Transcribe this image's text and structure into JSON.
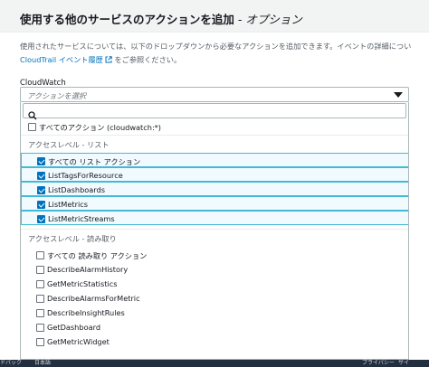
{
  "header": {
    "title": "使用する他のサービスのアクションを追加",
    "optional": " - オプション"
  },
  "description": {
    "line1": "使用されたサービスについては、以下のドロップダウンから必要なアクションを追加できます。イベントの詳細につい",
    "link": "CloudTrail イベント履歴",
    "link_icon": "external-link-icon",
    "line2_suffix": " をご参照ください。"
  },
  "field": {
    "label": "CloudWatch",
    "placeholder": "アクションを選択",
    "caret_icon": "caret-down-icon"
  },
  "dropdown": {
    "search_icon": "search-icon",
    "search_placeholder": "",
    "all_actions": "すべてのアクション (cloudwatch:*)",
    "groups": [
      {
        "header": "アクセスレベル - リスト",
        "items": [
          {
            "label": "すべての リスト アクション",
            "checked": true
          },
          {
            "label": "ListTagsForResource",
            "checked": true
          },
          {
            "label": "ListDashboards",
            "checked": true
          },
          {
            "label": "ListMetrics",
            "checked": true
          },
          {
            "label": "ListMetricStreams",
            "checked": true
          }
        ]
      },
      {
        "header": "アクセスレベル - 読み取り",
        "items": [
          {
            "label": "すべての 読み取り アクション",
            "checked": false
          },
          {
            "label": "DescribeAlarmHistory",
            "checked": false
          },
          {
            "label": "GetMetricStatistics",
            "checked": false
          },
          {
            "label": "DescribeAlarmsForMetric",
            "checked": false
          },
          {
            "label": "DescribeInsightRules",
            "checked": false
          },
          {
            "label": "GetDashboard",
            "checked": false
          },
          {
            "label": "GetMetricWidget",
            "checked": false
          }
        ]
      }
    ]
  },
  "footer": {
    "left1": "ドバック",
    "left2": "日本語",
    "right1": "プライバシー",
    "right2": "サイ"
  },
  "colors": {
    "accent": "#0073bb",
    "selected_bg": "#f1faff",
    "selected_border": "#44b9d6",
    "footer_bg": "#232f3e"
  }
}
